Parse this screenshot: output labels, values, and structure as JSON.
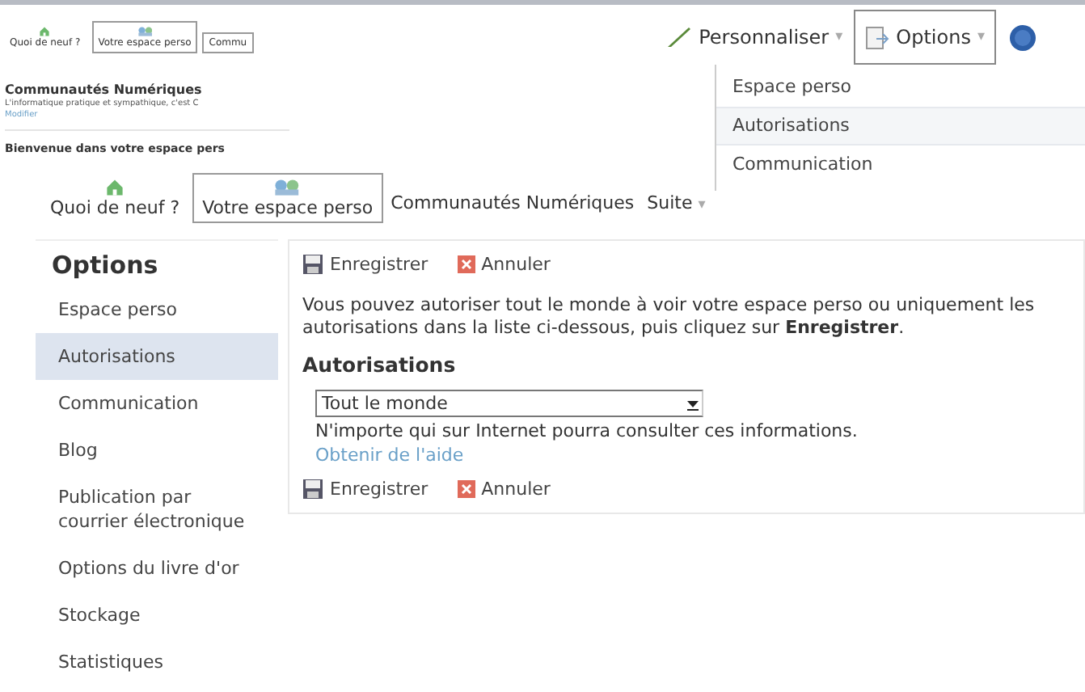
{
  "inset": {
    "tabs": [
      {
        "label": "Quoi de neuf ?",
        "kind": "home",
        "selected": false
      },
      {
        "label": "Votre espace perso",
        "kind": "spaces",
        "selected": true
      },
      {
        "label": "Commu",
        "kind": "plain",
        "selected": true
      }
    ],
    "title": "Communautés Numériques",
    "tagline": "L'informatique pratique et sympathique, c'est C",
    "edit_link": "Modifier",
    "welcome": "Bienvenue dans votre espace pers"
  },
  "toolbar": {
    "customize": "Personnaliser",
    "options": "Options",
    "caret": "▾"
  },
  "options_menu": [
    {
      "label": "Espace perso",
      "hovered": false
    },
    {
      "label": "Autorisations",
      "hovered": true
    },
    {
      "label": "Communication",
      "hovered": false
    }
  ],
  "nav": {
    "tabs": [
      {
        "label": "Quoi de neuf ?",
        "kind": "home",
        "selected": false
      },
      {
        "label": "Votre espace perso",
        "kind": "spaces",
        "selected": true
      },
      {
        "label": "Communautés Numériques",
        "kind": "plain",
        "selected": false
      }
    ],
    "more": "Suite",
    "caret": "▾"
  },
  "sidebar": {
    "title": "Options",
    "items": [
      {
        "label": "Espace perso",
        "selected": false
      },
      {
        "label": "Autorisations",
        "selected": true
      },
      {
        "label": "Communication",
        "selected": false
      },
      {
        "label": "Blog",
        "selected": false
      },
      {
        "label": "Publication par courrier électronique",
        "selected": false
      },
      {
        "label": "Options du livre d'or",
        "selected": false
      },
      {
        "label": "Stockage",
        "selected": false
      },
      {
        "label": "Statistiques",
        "selected": false
      }
    ]
  },
  "main": {
    "actions_top": [
      {
        "kind": "save",
        "label": "Enregistrer"
      },
      {
        "kind": "cancel",
        "label": "Annuler"
      }
    ],
    "description": [
      "Vous pouvez autoriser tout le monde à voir votre espace perso ou uniquement les",
      "autorisations dans la liste ci-dessous, puis cliquez sur **Enregistrer**."
    ],
    "section_title": "Autorisations",
    "select_value": "Tout le monde",
    "hint": "N'importe qui sur Internet pourra consulter ces informations.",
    "help_link": "Obtenir de l'aide",
    "actions_bottom": [
      {
        "kind": "save",
        "label": "Enregistrer"
      },
      {
        "kind": "cancel",
        "label": "Annuler"
      }
    ]
  }
}
